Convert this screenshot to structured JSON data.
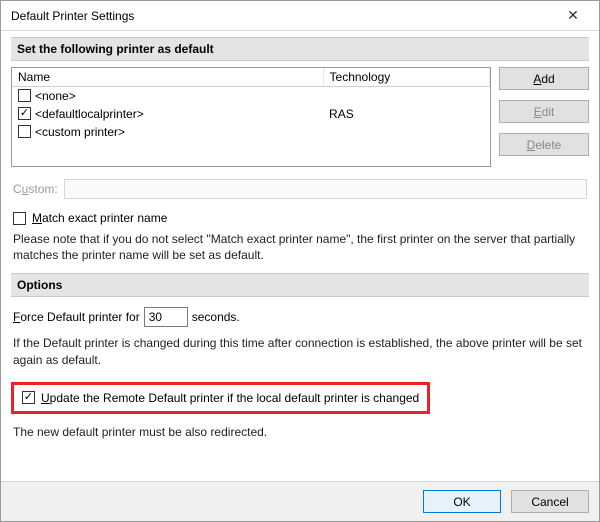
{
  "window": {
    "title": "Default Printer Settings"
  },
  "section1": {
    "header": "Set the following printer as default",
    "columns": {
      "name": "Name",
      "technology": "Technology"
    },
    "rows": [
      {
        "checked": false,
        "name": "<none>",
        "technology": ""
      },
      {
        "checked": true,
        "name": "<defaultlocalprinter>",
        "technology": "RAS"
      },
      {
        "checked": false,
        "name": "<custom printer>",
        "technology": ""
      }
    ],
    "buttons": {
      "add": {
        "pre": "",
        "u": "A",
        "post": "dd"
      },
      "edit": {
        "pre": "",
        "u": "E",
        "post": "dit"
      },
      "delete": {
        "pre": "",
        "u": "D",
        "post": "elete"
      }
    },
    "custom": {
      "pre": "C",
      "u": "u",
      "post": "stom:"
    },
    "match": {
      "pre": "",
      "u": "M",
      "post": "atch exact printer name",
      "checked": false
    },
    "note": "Please note that if you do not select \"Match exact printer name\", the first printer on the server that partially matches the printer name will be set as default."
  },
  "options": {
    "header": "Options",
    "force": {
      "pre": "",
      "u": "F",
      "post": "orce Default printer for",
      "value": "30",
      "suffix": "seconds."
    },
    "force_note": "If the Default printer is changed during this time after connection is established, the above printer will be set again as default.",
    "update": {
      "checked": true,
      "pre": "",
      "u": "U",
      "post": "pdate the Remote Default printer if the local default printer is changed"
    },
    "update_note": "The new default printer must be also redirected."
  },
  "footer": {
    "ok": "OK",
    "cancel": "Cancel"
  }
}
